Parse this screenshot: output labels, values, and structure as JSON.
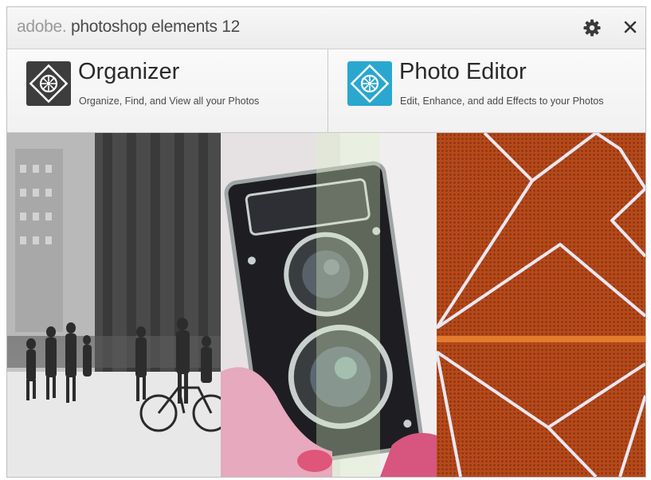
{
  "window": {
    "title_brand": "adobe",
    "title_product": "photoshop elements 12",
    "settings_icon": "gear-icon",
    "close_icon": "close-icon"
  },
  "tiles": [
    {
      "id": "organizer",
      "title": "Organizer",
      "subtitle": "Organize, Find, and View all your Photos",
      "icon": "organizer-app-icon",
      "icon_color": "#3d3d3d"
    },
    {
      "id": "photo-editor",
      "title": "Photo Editor",
      "subtitle": "Edit, Enhance, and add Effects to your Photos",
      "icon": "photo-editor-app-icon",
      "icon_color": "#2aa7cf"
    }
  ],
  "photos": [
    {
      "subject": "black-and-white city street with pedestrians and cyclist"
    },
    {
      "subject": "vintage twin-lens camera held in hand"
    },
    {
      "subject": "orange perforated surface with white geometric lines"
    }
  ],
  "colors": {
    "accent_blue": "#2aa7cf",
    "orange_photo": "#b5491a"
  }
}
